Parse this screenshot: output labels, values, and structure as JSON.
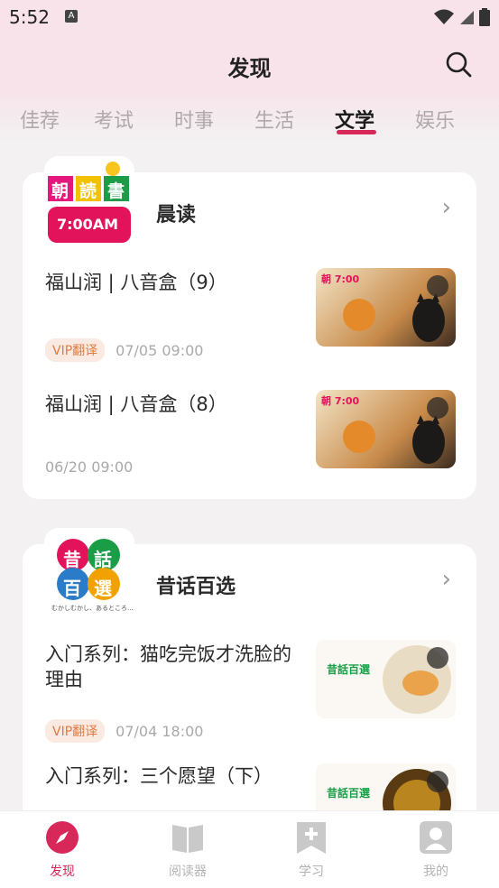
{
  "status": {
    "time": "5:52",
    "notify": "A"
  },
  "header": {
    "title": "发现"
  },
  "tabs": [
    {
      "label": "佳荐"
    },
    {
      "label": "考试"
    },
    {
      "label": "时事"
    },
    {
      "label": "生活"
    },
    {
      "label": "文学",
      "active": true
    },
    {
      "label": "娱乐"
    }
  ],
  "cards": [
    {
      "title": "晨读",
      "logo": {
        "line1": [
          "朝",
          "読",
          "書"
        ],
        "time": "7:00AM"
      },
      "items": [
        {
          "title": "福山润 | 八音盒（9）",
          "vip": "VIP翻译",
          "date": "07/05 09:00",
          "thumb_text": "朝 7:00"
        },
        {
          "title": "福山润 | 八音盒（8）",
          "vip": "",
          "date": "06/20 09:00",
          "thumb_text": "朝 7:00"
        }
      ]
    },
    {
      "title": "昔话百选",
      "logo": {
        "chars": [
          "昔",
          "話",
          "百",
          "選"
        ],
        "caption": "むかしむかし、あるところ..."
      },
      "items": [
        {
          "title": "入门系列：猫吃完饭才洗脸的理由",
          "vip": "VIP翻译",
          "date": "07/04 18:00",
          "thumb_text": "昔話百選"
        },
        {
          "title": "入门系列：三个愿望（下）",
          "vip": "",
          "date": "",
          "thumb_text": "昔話百選"
        }
      ]
    }
  ],
  "nav": [
    {
      "label": "发现",
      "icon": "compass-icon",
      "active": true
    },
    {
      "label": "阅读器",
      "icon": "book-icon"
    },
    {
      "label": "学习",
      "icon": "bookmark-plus-icon"
    },
    {
      "label": "我的",
      "icon": "user-icon"
    }
  ],
  "colors": {
    "accent": "#d8285a",
    "vip_bg": "#fbeae2",
    "vip_text": "#e07a43"
  }
}
